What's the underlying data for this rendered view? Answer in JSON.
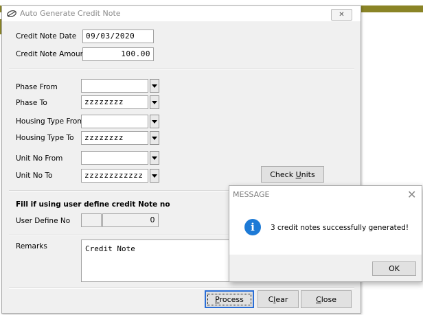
{
  "window": {
    "title": "Auto Generate Credit Note",
    "close_glyph": "✕"
  },
  "form": {
    "credit_note_date": {
      "label": "Credit Note Date",
      "value": "09/03/2020"
    },
    "credit_note_amount": {
      "label": "Credit Note Amount",
      "value": "100.00"
    },
    "phase_from": {
      "label": "Phase From",
      "value": ""
    },
    "phase_to": {
      "label": "Phase To",
      "value": "zzzzzzzz"
    },
    "housing_type_from": {
      "label": "Housing Type From",
      "value": ""
    },
    "housing_type_to": {
      "label": "Housing Type To",
      "value": "zzzzzzzz"
    },
    "unit_no_from": {
      "label": "Unit No From",
      "value": ""
    },
    "unit_no_to": {
      "label": "Unit No To",
      "value": "zzzzzzzzzzzz"
    },
    "check_units_prefix": "Check ",
    "check_units_key": "U",
    "check_units_rest": "nits",
    "user_define_heading": "Fill if using user define credit Note no",
    "user_define_no": {
      "label": "User Define No",
      "prefix": "",
      "value": "0"
    },
    "remarks": {
      "label": "Remarks",
      "value": "Credit Note"
    }
  },
  "buttons": {
    "process_key": "P",
    "process_rest": "rocess",
    "clear_first": "C",
    "clear_key": "l",
    "clear_rest": "ear",
    "close_key": "C",
    "close_rest": "lose"
  },
  "message": {
    "title": "MESSAGE",
    "close_glyph": "✕",
    "icon_glyph": "i",
    "text": "3 credit notes successfully generated!",
    "ok_label": "OK"
  },
  "icons": [
    "app-icon",
    "info-icon",
    "dropdown-arrow-icon"
  ],
  "colors": {
    "accent": "#2a6ed6",
    "info": "#1d7ad6",
    "background_bar": "#8a8426"
  }
}
